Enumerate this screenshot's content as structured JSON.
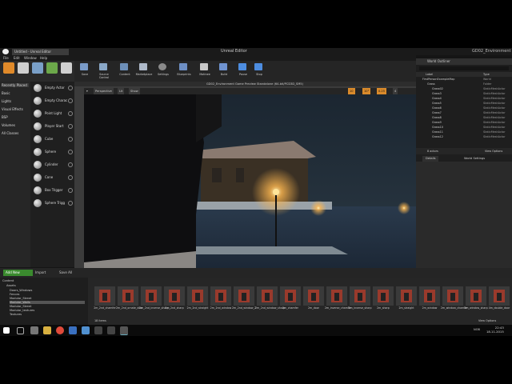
{
  "app": {
    "tab_title": "Untitled - Unreal Editor",
    "project_name": "GD02_Environment",
    "window_label": "Unreal Editor"
  },
  "menu": [
    "File",
    "Edit",
    "Window",
    "Help"
  ],
  "toolbar": [
    "Save",
    "Source Control",
    "Content",
    "Marketplace",
    "Settings",
    "Blueprints",
    "Matinee",
    "Build",
    "Pause",
    "Stop"
  ],
  "modes": {
    "categories": [
      "Recently Placed",
      "Basic",
      "Lights",
      "Visual Effects",
      "BSP",
      "Volumes",
      "All Classes"
    ],
    "items": [
      "Empty Actor",
      "Empty Charac",
      "Point Light",
      "Player Start",
      "Cube",
      "Sphere",
      "Cylinder",
      "Cone",
      "Box Trigger",
      "Sphere Trigg"
    ]
  },
  "viewport": {
    "title": "GD02_Environment Game Preview Standalone (64-bit/PCD3D_SM5)",
    "buttons": [
      "Perspective",
      "Lit",
      "Show"
    ],
    "numbers": [
      "10",
      "10°",
      "0.25",
      "4"
    ]
  },
  "outliner": {
    "title": "World Outliner",
    "columns": [
      "Label",
      "Type"
    ],
    "rows": [
      {
        "name": "FirstPersonExampleMap",
        "type": "World"
      },
      {
        "name": "Grass",
        "type": "Folder"
      },
      {
        "name": "Grass02",
        "type": "StaticMeshActor"
      },
      {
        "name": "Grass3",
        "type": "StaticMeshActor"
      },
      {
        "name": "Grass4",
        "type": "StaticMeshActor"
      },
      {
        "name": "Grass5",
        "type": "StaticMeshActor"
      },
      {
        "name": "Grass6",
        "type": "StaticMeshActor"
      },
      {
        "name": "Grass7",
        "type": "StaticMeshActor"
      },
      {
        "name": "Grass8",
        "type": "StaticMeshActor"
      },
      {
        "name": "Grass9",
        "type": "StaticMeshActor"
      },
      {
        "name": "Grass10",
        "type": "StaticMeshActor"
      },
      {
        "name": "Grass11",
        "type": "StaticMeshActor"
      },
      {
        "name": "Grass12",
        "type": "StaticMeshActor"
      }
    ],
    "count": "8 actors",
    "view_options": "View Options"
  },
  "details": {
    "tabs": [
      "Details",
      "World Settings"
    ]
  },
  "content": {
    "add_new": "Add New",
    "import": "Import",
    "save_all": "Save All",
    "root": "Content",
    "folders": [
      "Assets",
      "Doors_Windows",
      "Fences",
      "Modular_Street",
      "Modular_Walls",
      "Modular_Street",
      "Modular_textures",
      "Textures"
    ],
    "items_count": "18 items",
    "view_options": "View Options",
    "assets": [
      "2m_2nd_chamfer",
      "2m_2nd_ornate_door",
      "2m_2nd_inverse_sharp",
      "2m_2nd_sharp",
      "2m_2nd_straight",
      "2m_2nd_window",
      "2m_2nd_window_2",
      "2m_2nd_window_sharp",
      "2m_chamfer",
      "2m_door",
      "2m_inverse_chamfer",
      "2m_inverse_sharp",
      "2m_sharp",
      "2m_straight",
      "2m_window",
      "2m_window_chamfer",
      "2m_window_sharp",
      "4m_double_door"
    ]
  },
  "clock": {
    "time": "22:43",
    "date": "18.11.2015",
    "lang": "NOB"
  },
  "colors": {
    "accent_green": "#3a8a2e",
    "panel": "#262626",
    "viewport_sky": "#23303c"
  }
}
